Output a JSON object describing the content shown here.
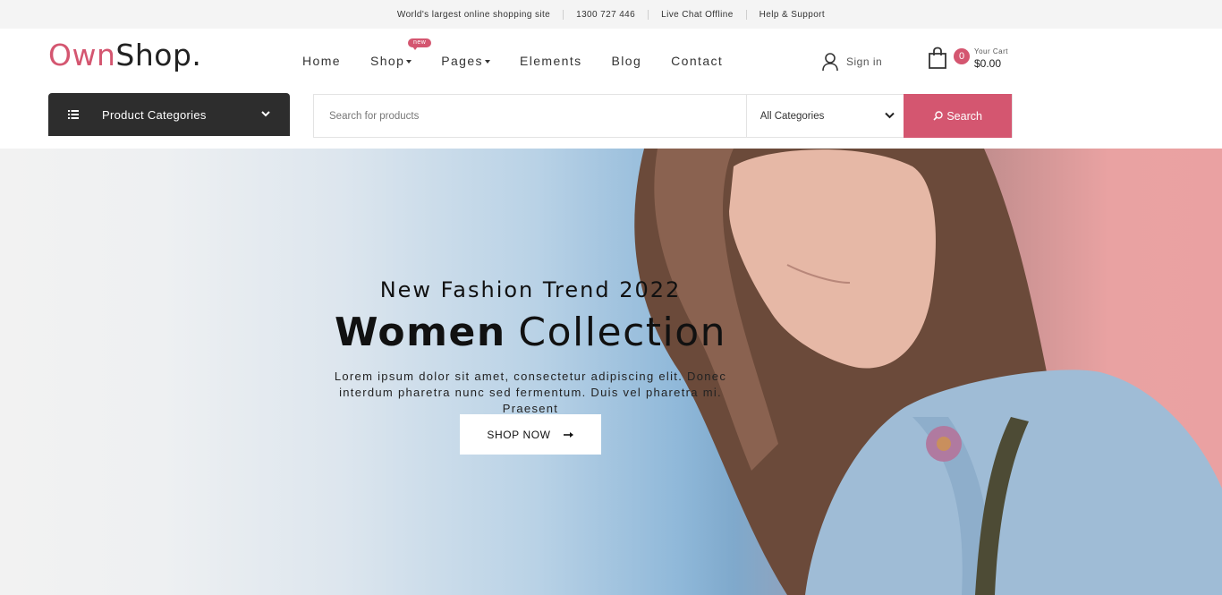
{
  "topbar": {
    "items": [
      "World's largest online shopping site",
      "1300 727 446",
      "Live Chat Offline",
      "Help & Support"
    ]
  },
  "logo": {
    "part1": "Own",
    "part2": "Shop."
  },
  "nav": {
    "items": [
      "Home",
      "Shop",
      "Pages",
      "Elements",
      "Blog",
      "Contact"
    ],
    "badge": "new"
  },
  "account": {
    "signin_label": "Sign in"
  },
  "cart": {
    "count": "0",
    "label": "Your Cart",
    "amount": "$0.00"
  },
  "categories": {
    "label": "Product Categories"
  },
  "search": {
    "placeholder": "Search for products",
    "category_selected": "All Categories",
    "button_label": "Search"
  },
  "hero": {
    "subtitle": "New Fashion Trend 2022",
    "title_bold": "Women",
    "title_light": "Collection",
    "description": "Lorem ipsum dolor sit amet, consectetur adipiscing elit. Donec interdum pharetra nunc sed fermentum. Duis vel pharetra mi. Praesent",
    "cta_label": "SHOP NOW"
  },
  "colors": {
    "accent": "#d45670",
    "dark": "#2d2d2d",
    "topbar_bg": "#f4f4f4"
  },
  "icons": {
    "user": "user-icon",
    "cart": "shopping-bag-icon",
    "categories": "list-icon",
    "search": "search-icon",
    "arrow": "arrow-right-icon"
  }
}
